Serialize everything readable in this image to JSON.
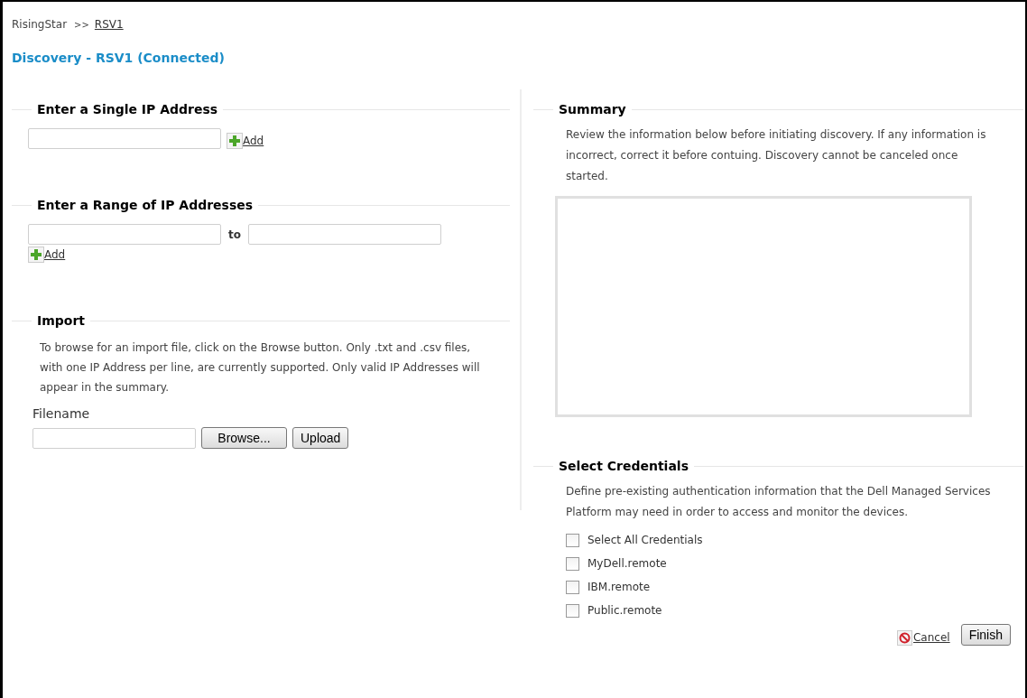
{
  "breadcrumb": {
    "root": "RisingStar",
    "separator": ">>",
    "current": "RSV1"
  },
  "page_title": "Discovery - RSV1 (Connected)",
  "single_ip": {
    "heading": "Enter a Single IP Address",
    "add": "Add"
  },
  "range_ip": {
    "heading": "Enter a Range of IP Addresses",
    "to": "to",
    "add": "Add"
  },
  "import": {
    "heading": "Import",
    "description": "To browse for an import file, click on the Browse button. Only .txt and .csv files, with one IP Address per line, are currently supported. Only valid IP Addresses will appear in the summary.",
    "filename_label": "Filename",
    "browse": "Browse...",
    "upload": "Upload"
  },
  "summary": {
    "heading": "Summary",
    "description": "Review the information below before initiating discovery. If any information is incorrect, correct it before contuing. Discovery cannot be canceled once started."
  },
  "credentials": {
    "heading": "Select Credentials",
    "description": "Define pre-existing authentication information that the Dell Managed Services Platform may need in order to access and monitor the devices.",
    "items": [
      {
        "label": "Select All Credentials",
        "checked": false
      },
      {
        "label": "MyDell.remote",
        "checked": false
      },
      {
        "label": "IBM.remote",
        "checked": false
      },
      {
        "label": "Public.remote",
        "checked": false
      }
    ]
  },
  "actions": {
    "cancel": "Cancel",
    "finish": "Finish"
  }
}
